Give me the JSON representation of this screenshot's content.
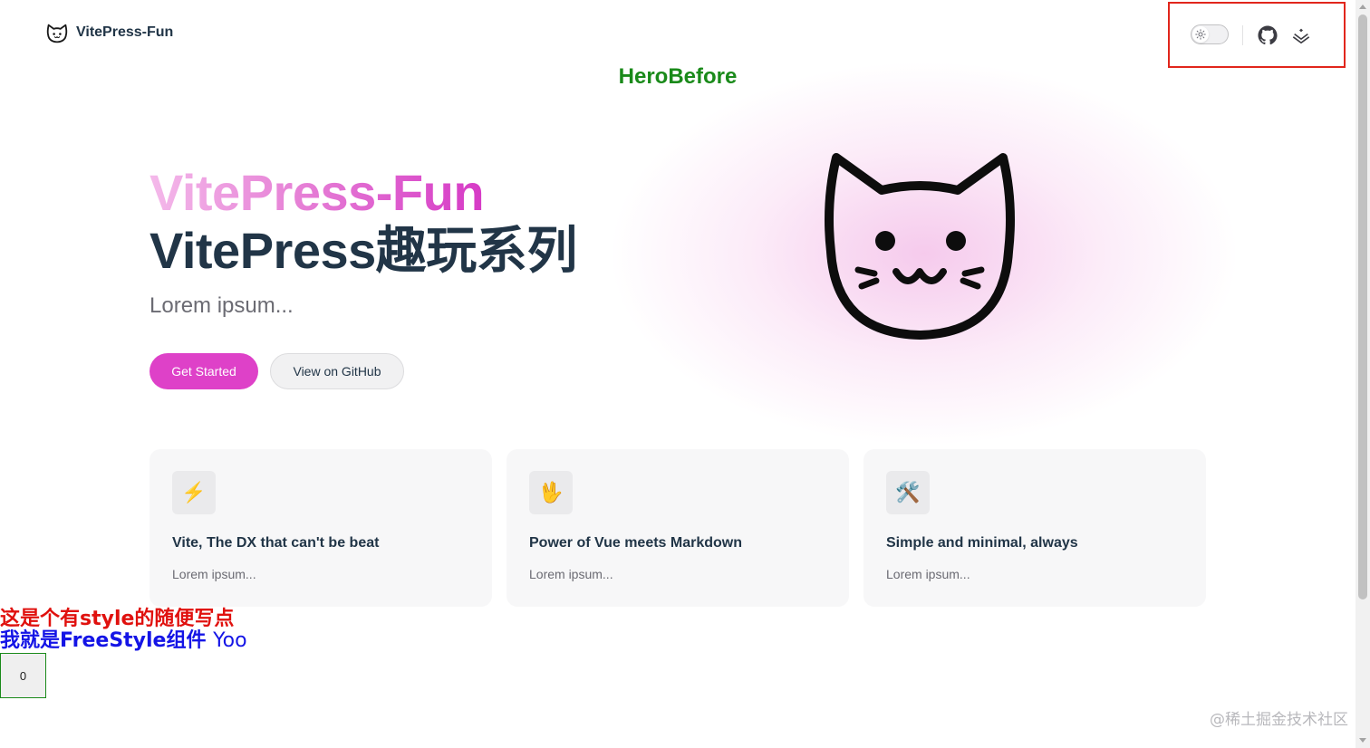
{
  "nav": {
    "brand_title": "VitePress-Fun",
    "logo_icon": "cat-face-icon",
    "actions": [
      {
        "name": "theme-switch",
        "icon": "sun-icon"
      },
      {
        "name": "github-link",
        "icon": "github-icon"
      },
      {
        "name": "juejin-link",
        "icon": "juejin-icon"
      }
    ],
    "actions_highlight_color": "#e1261c"
  },
  "hero": {
    "before_text": "HeroBefore",
    "name": "VitePress-Fun",
    "text": "VitePress趣玩系列",
    "tagline": "Lorem ipsum...",
    "actions": [
      {
        "label": "Get Started",
        "theme": "brand"
      },
      {
        "label": "View on GitHub",
        "theme": "alt"
      }
    ],
    "image_icon": "cat-face-icon",
    "brand_color": "#de41c8"
  },
  "features": [
    {
      "icon": "⚡️",
      "icon_name": "lightning-icon",
      "title": "Vite, The DX that can't be beat",
      "details": "Lorem ipsum..."
    },
    {
      "icon": "🖖",
      "icon_name": "vulcan-salute-icon",
      "title": "Power of Vue meets Markdown",
      "details": "Lorem ipsum..."
    },
    {
      "icon": "🛠️",
      "icon_name": "tools-icon",
      "title": "Simple and minimal, always",
      "details": "Lorem ipsum..."
    }
  ],
  "free_style": {
    "styled_text": "这是个有style的随便写点",
    "component_text": "我就是FreeStyle组件",
    "component_suffix": "Yoo",
    "counter_value": "0"
  },
  "watermark": "@稀土掘金技术社区"
}
